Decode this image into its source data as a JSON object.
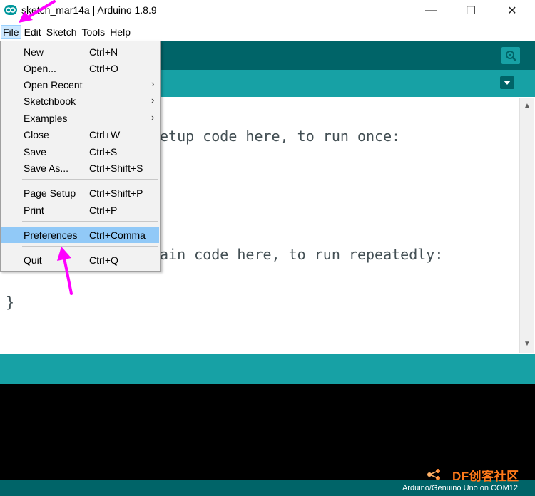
{
  "window": {
    "title": "sketch_mar14a | Arduino 1.8.9",
    "controls": {
      "minimize": "—",
      "maximize": "☐",
      "close": "✕"
    }
  },
  "menubar": {
    "items": [
      {
        "label": "File",
        "active": true
      },
      {
        "label": "Edit"
      },
      {
        "label": "Sketch"
      },
      {
        "label": "Tools"
      },
      {
        "label": "Help"
      }
    ]
  },
  "file_menu": {
    "items": [
      {
        "label": "New",
        "shortcut": "Ctrl+N"
      },
      {
        "label": "Open...",
        "shortcut": "Ctrl+O"
      },
      {
        "label": "Open Recent",
        "shortcut": "",
        "submenu": true
      },
      {
        "label": "Sketchbook",
        "shortcut": "",
        "submenu": true
      },
      {
        "label": "Examples",
        "shortcut": "",
        "submenu": true
      },
      {
        "label": "Close",
        "shortcut": "Ctrl+W"
      },
      {
        "label": "Save",
        "shortcut": "Ctrl+S"
      },
      {
        "label": "Save As...",
        "shortcut": "Ctrl+Shift+S"
      },
      {
        "label": "Page Setup",
        "shortcut": "Ctrl+Shift+P"
      },
      {
        "label": "Print",
        "shortcut": "Ctrl+P"
      },
      {
        "label": "Preferences",
        "shortcut": "Ctrl+Comma",
        "highlighted": true
      },
      {
        "label": "Quit",
        "shortcut": "Ctrl+Q"
      }
    ]
  },
  "editor": {
    "lines": [
      "etup code here, to run once:",
      "ain code here, to run repeatedly:",
      "}"
    ]
  },
  "status": {
    "board": "Arduino/Genuino Uno on COM12"
  },
  "watermark": {
    "text": "DF创客社区"
  },
  "colors": {
    "toolbar": "#006468",
    "tabstrip": "#17a1a5",
    "highlight": "#91c9f7",
    "annotation_arrow": "#ff00ff"
  }
}
